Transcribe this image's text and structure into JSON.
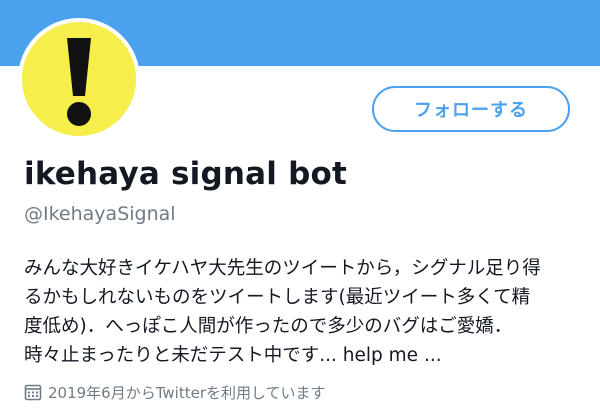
{
  "profile": {
    "follow_label": "フォローする",
    "display_name": "ikehaya signal bot",
    "handle": "@IkehayaSignal",
    "bio_lines": [
      "みんな大好きイケハヤ大先生のツイートから，シグナル足り得",
      "るかもしれないものをツイートします(最近ツイート多くて精",
      "度低め)．へっぽこ人間が作ったので多少のバグはご愛嬌．",
      "時々止まったりと未だテスト中です... help me ..."
    ],
    "joined_text": "2019年6月からTwitterを利用しています",
    "joined_icon": "calendar-icon",
    "avatar_icon": "exclamation-icon"
  },
  "colors": {
    "banner": "#4aa1ee",
    "accent": "#4aa1ee",
    "avatar_bg": "#f5ee4b",
    "secondary_text": "#707b85"
  }
}
